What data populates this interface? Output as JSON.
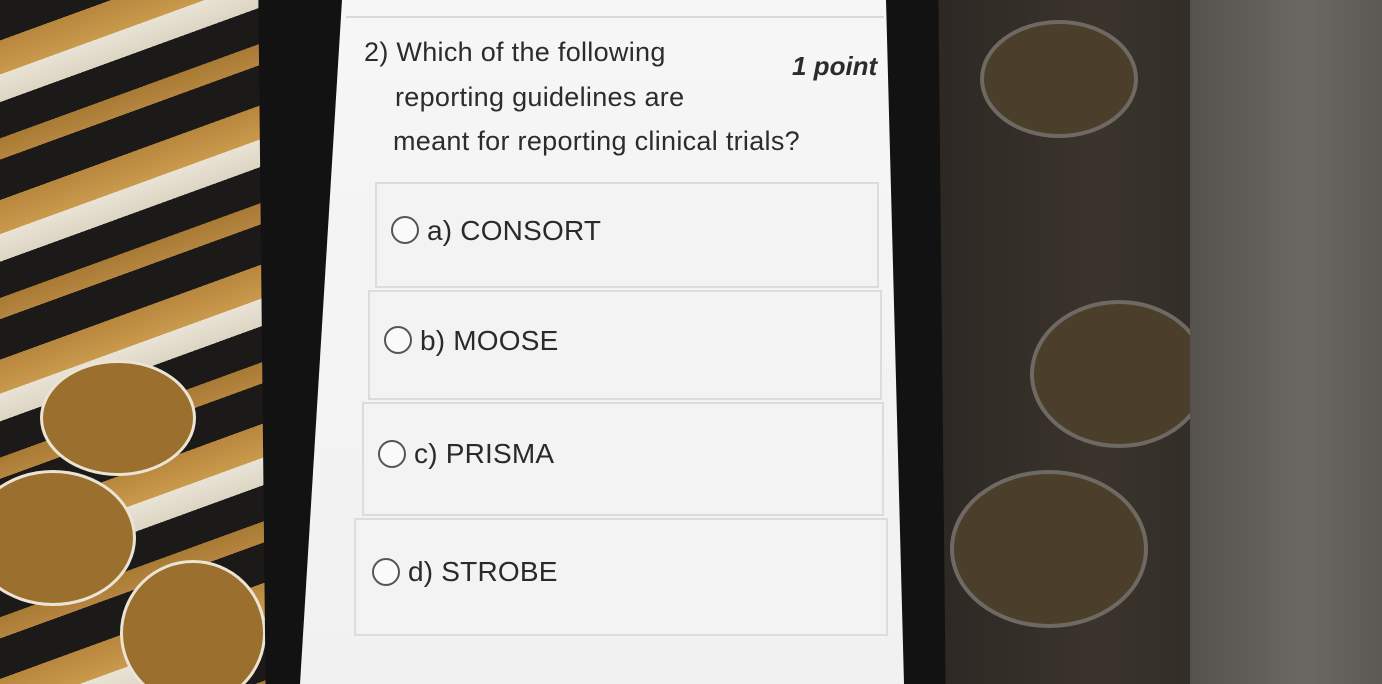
{
  "question": {
    "number_label": "2)",
    "lines": [
      "Which of the following",
      "reporting guidelines are",
      "meant for reporting clinical trials?"
    ],
    "points": "1 point"
  },
  "options": [
    {
      "label": "a) CONSORT",
      "selected": false
    },
    {
      "label": "b) MOOSE",
      "selected": false
    },
    {
      "label": "c) PRISMA",
      "selected": false
    },
    {
      "label": "d) STROBE",
      "selected": false
    }
  ],
  "colors": {
    "screen_background": "#f4f4f4",
    "text": "#2c2c2c",
    "option_border": "#dcdcdc",
    "radio_border": "#555555"
  }
}
